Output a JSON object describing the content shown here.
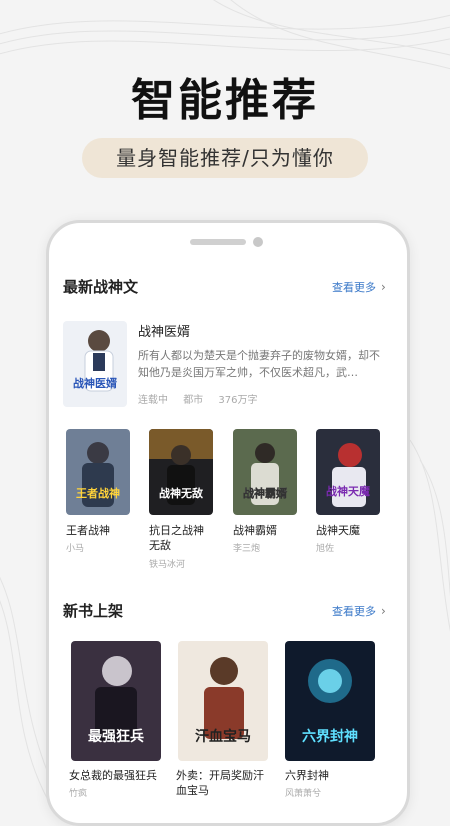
{
  "headline": "智能推荐",
  "tagline": "量身智能推荐/只为懂你",
  "sections": [
    {
      "title": "最新战神文",
      "more": "查看更多",
      "featured": {
        "title": "战神医婿",
        "description": "所有人都以为楚天是个抛妻弃子的废物女婿，却不知他乃是炎国万军之帅，不仅医术超凡，武…",
        "status": "连载中",
        "category": "都市",
        "words": "376万字",
        "cover_text": "战神医婿"
      },
      "books": [
        {
          "name": "王者战神",
          "author": "小马",
          "cover_text": "王者战神"
        },
        {
          "name": "抗日之战神无敌",
          "author": "铁马冰河",
          "cover_text": "战神无敌"
        },
        {
          "name": "战神霸婿",
          "author": "李三炮",
          "cover_text": "战神霸婿"
        },
        {
          "name": "战神天魔",
          "author": "旭佐",
          "cover_text": "战神天魔"
        }
      ]
    },
    {
      "title": "新书上架",
      "more": "查看更多",
      "books": [
        {
          "name": "女总裁的最强狂兵",
          "author": "竹疯",
          "cover_text": "最强狂兵"
        },
        {
          "name": "外卖：开局奖励汗血宝马",
          "author": "三只鸟",
          "cover_text": "汗血宝马"
        },
        {
          "name": "六界封神",
          "author": "风萧萧兮",
          "cover_text": "六界封神"
        }
      ]
    }
  ],
  "icons": {
    "more": "chevron-right-icon"
  },
  "colors": {
    "accent": "#3a78c8",
    "pill": "#efe5d6"
  }
}
